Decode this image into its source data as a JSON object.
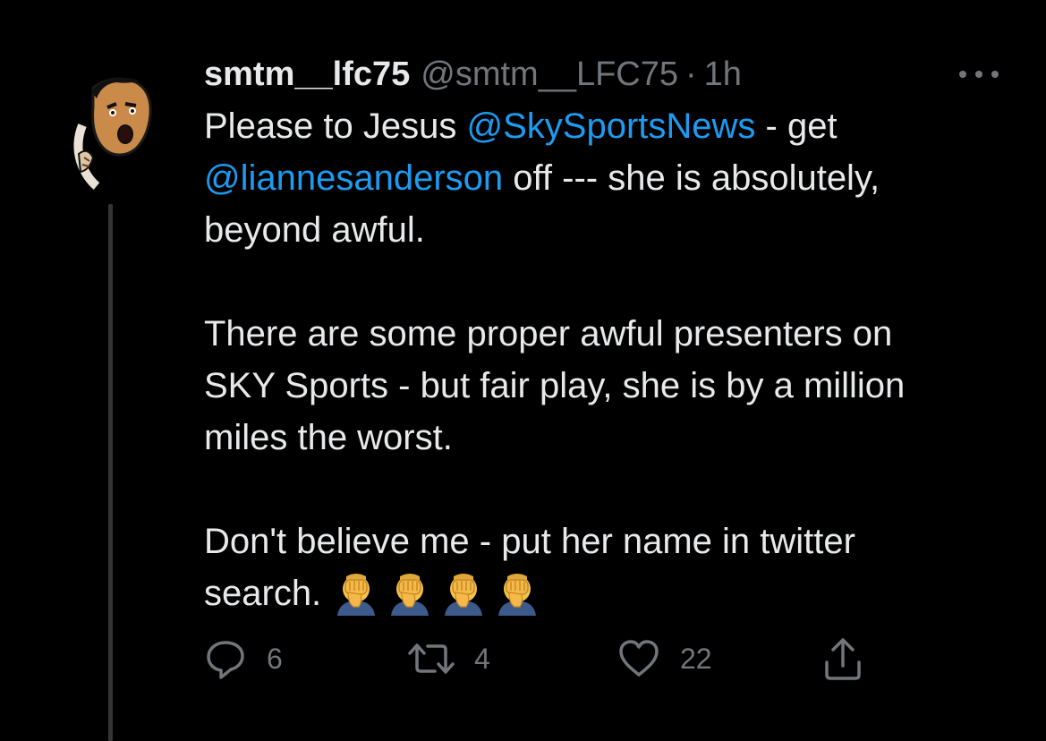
{
  "tweet": {
    "display_name": "smtm__lfc75",
    "handle": "@smtm__LFC75",
    "separator": "·",
    "time": "1h",
    "body": {
      "p1_pre": "Please to Jesus ",
      "mention1": "@SkySportsNews",
      "p1_mid": " - get",
      "mention2": "@liannesanderson",
      "p1_post": " off --- she is absolutely,",
      "p1_end": "beyond awful.",
      "p2_line1": "There are some proper awful presenters on",
      "p2_line2": "SKY Sports - but fair play, she is by a million",
      "p2_line3": "miles the worst.",
      "p3_line1": "Don't believe me - put her name in twitter",
      "p3_line2": "search."
    },
    "emoji": [
      "facepalm",
      "facepalm",
      "facepalm",
      "facepalm"
    ]
  },
  "actions": {
    "reply_count": "6",
    "retweet_count": "4",
    "like_count": "22"
  },
  "icons": {
    "reply": "reply-icon",
    "retweet": "retweet-icon",
    "like": "heart-icon",
    "share": "share-icon",
    "more": "more-icon"
  },
  "colors": {
    "background": "#000000",
    "text": "#e7e9ea",
    "secondary": "#71767b",
    "link": "#1d9bf0",
    "thread_line": "#333639"
  }
}
